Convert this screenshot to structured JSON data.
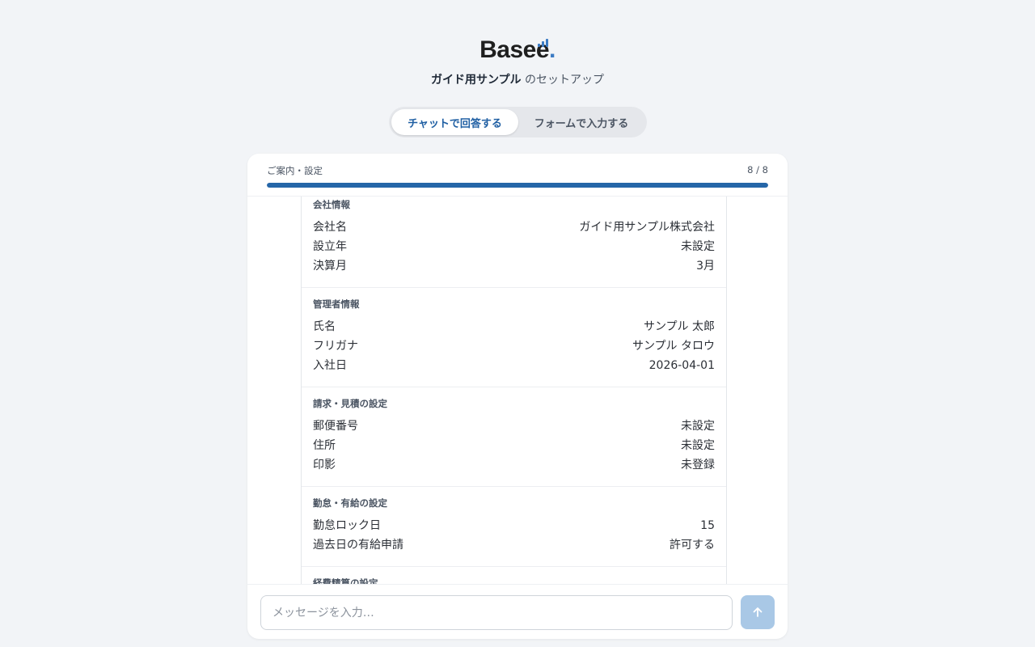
{
  "header": {
    "logo_text": "Basee",
    "logo_dot": ".",
    "company_name": "ガイド用サンプル",
    "setup_suffix": " のセットアップ"
  },
  "mode_toggle": {
    "chat_label": "チャットで回答する",
    "form_label": "フォームで入力する",
    "active": "chat"
  },
  "progress": {
    "step_label": "ご案内・設定",
    "counter": "8 / 8",
    "fraction": 1.0
  },
  "summary": {
    "sections": [
      {
        "title": "会社情報",
        "rows": [
          {
            "label": "会社名",
            "value": "ガイド用サンプル株式会社"
          },
          {
            "label": "設立年",
            "value": "未設定"
          },
          {
            "label": "決算月",
            "value": "3月"
          }
        ]
      },
      {
        "title": "管理者情報",
        "rows": [
          {
            "label": "氏名",
            "value": "サンプル 太郎"
          },
          {
            "label": "フリガナ",
            "value": "サンプル タロウ"
          },
          {
            "label": "入社日",
            "value": "2026-04-01"
          }
        ]
      },
      {
        "title": "請求・見積の設定",
        "rows": [
          {
            "label": "郵便番号",
            "value": "未設定"
          },
          {
            "label": "住所",
            "value": "未設定"
          },
          {
            "label": "印影",
            "value": "未登録"
          }
        ]
      },
      {
        "title": "勤怠・有給の設定",
        "rows": [
          {
            "label": "勤怠ロック日",
            "value": "15"
          },
          {
            "label": "過去日の有給申請",
            "value": "許可する"
          }
        ]
      },
      {
        "title": "経費精算の設定",
        "rows": []
      }
    ]
  },
  "composer": {
    "placeholder": "メッセージを入力…",
    "value": ""
  },
  "colors": {
    "accent": "#2566a8",
    "send_disabled": "#a9c8e6",
    "background": "#f2f4f7"
  },
  "icons": {
    "logo_mark": "signal-bars-icon",
    "send": "arrow-up-icon"
  }
}
